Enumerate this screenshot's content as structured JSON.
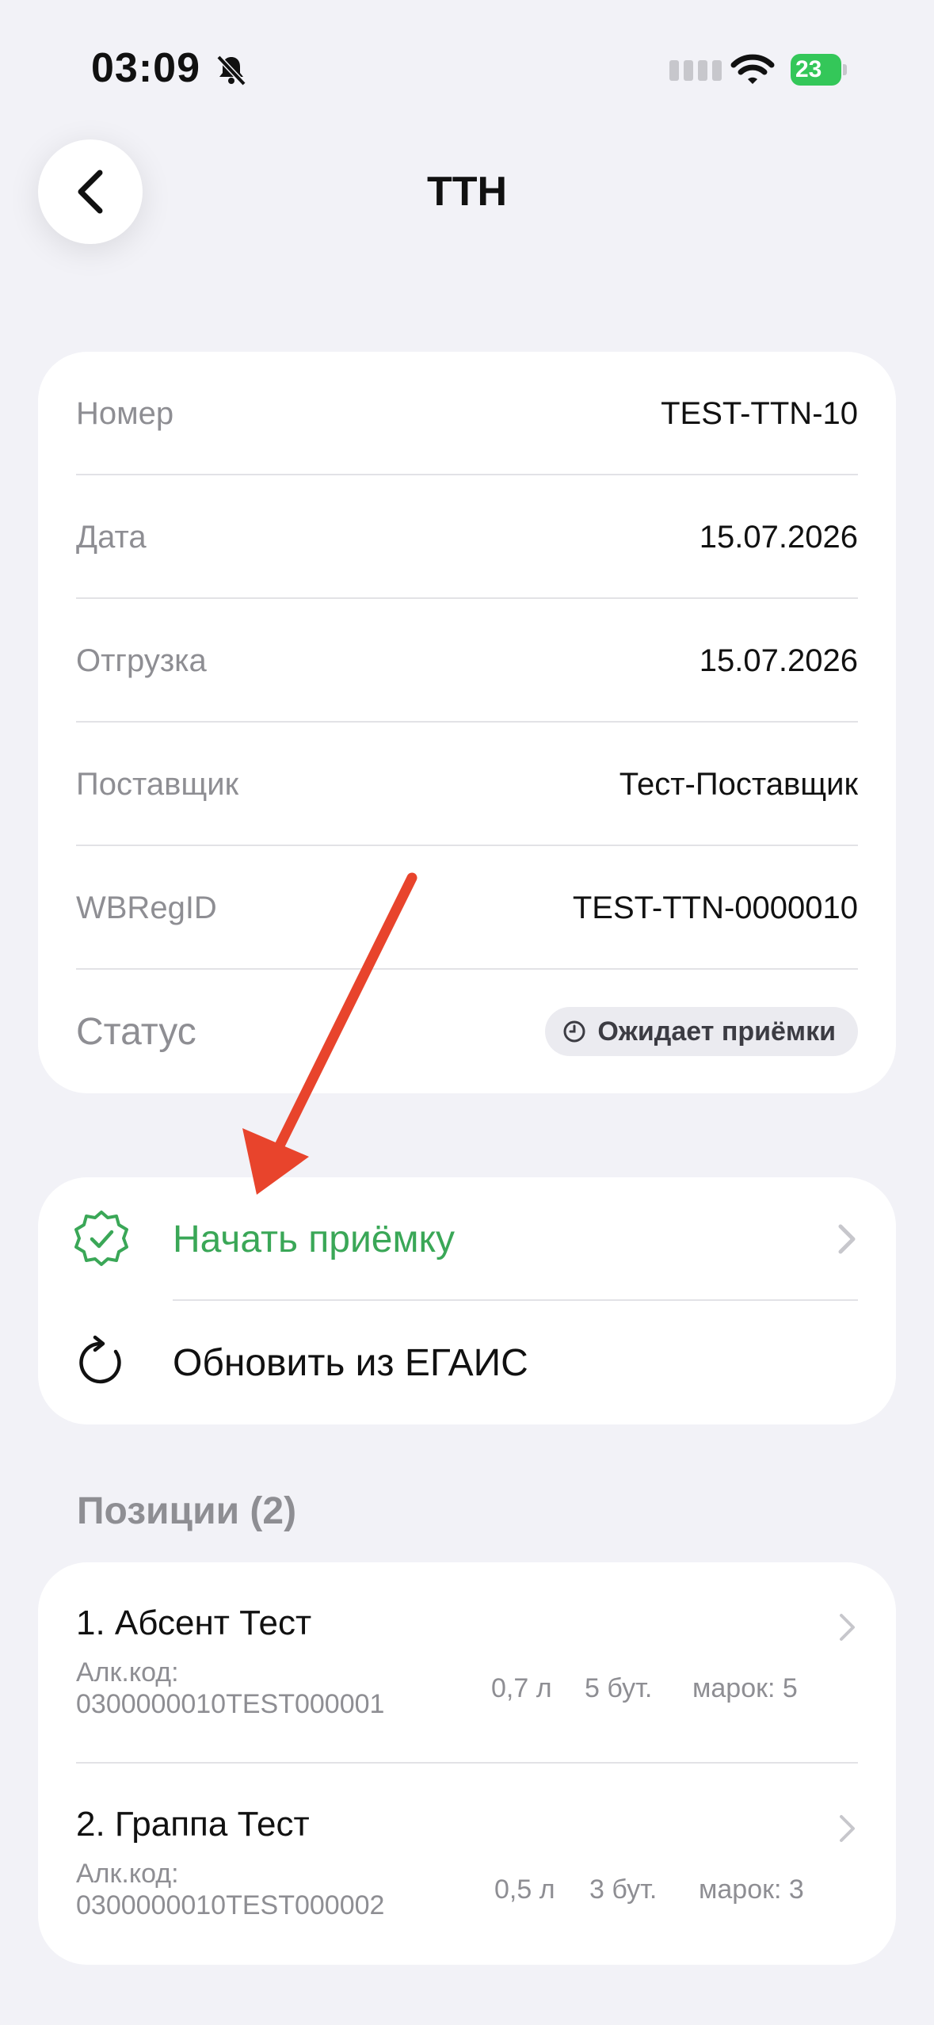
{
  "status_bar": {
    "time": "03:09",
    "battery": "23"
  },
  "header": {
    "title": "ТТН"
  },
  "info": {
    "rows": [
      {
        "label": "Номер",
        "value": "TEST-TTN-10"
      },
      {
        "label": "Дата",
        "value": "15.07.2026"
      },
      {
        "label": "Отгрузка",
        "value": "15.07.2026"
      },
      {
        "label": "Поставщик",
        "value": "Тест-Поставщик"
      },
      {
        "label": "WBRegID",
        "value": "TEST-TTN-0000010"
      }
    ],
    "status_label": "Статус",
    "status_value": "Ожидает приёмки"
  },
  "actions": {
    "start_label": "Начать приёмку",
    "refresh_label": "Обновить из ЕГАИС"
  },
  "positions": {
    "title": "Позиции (2)",
    "items": [
      {
        "title": "1. Абсент Тест",
        "code_label": "Алк.код:",
        "code": "0300000010TEST000001",
        "volume": "0,7 л",
        "qty": "5 бут.",
        "marks": "марок: 5"
      },
      {
        "title": "2. Граппа Тест",
        "code_label": "Алк.код:",
        "code": "0300000010TEST000002",
        "volume": "0,5 л",
        "qty": "3 бут.",
        "marks": "марок: 3"
      }
    ]
  },
  "colors": {
    "accent_green": "#3aa757",
    "annotation_arrow": "#e8442c"
  }
}
